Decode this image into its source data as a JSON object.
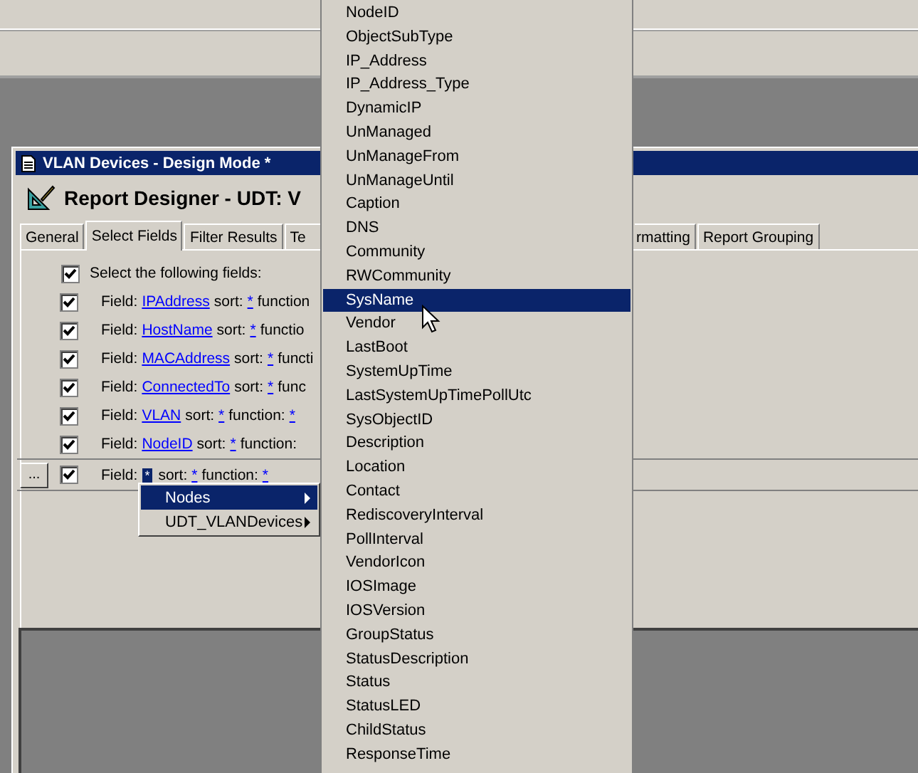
{
  "window": {
    "title": "VLAN Devices - Design Mode *"
  },
  "designer": {
    "title": "Report Designer - UDT: V"
  },
  "tabs": [
    {
      "label": "General",
      "selected": false
    },
    {
      "label": "Select Fields",
      "selected": true
    },
    {
      "label": "Filter Results",
      "selected": false
    },
    {
      "label": "Te",
      "selected": false
    },
    {
      "label": "rmatting",
      "selected": false
    },
    {
      "label": "Report Grouping",
      "selected": false
    }
  ],
  "select_all": {
    "label": "Select the following fields:",
    "checked": true
  },
  "fields": [
    {
      "checked": true,
      "prefix": "Field:",
      "name": "IPAddress",
      "name_selected": false,
      "sort_label": "sort:",
      "sort": "*",
      "function_label": "function"
    },
    {
      "checked": true,
      "prefix": "Field:",
      "name": "HostName",
      "name_selected": false,
      "sort_label": "sort:",
      "sort": "*",
      "function_label": "functio"
    },
    {
      "checked": true,
      "prefix": "Field:",
      "name": "MACAddress",
      "name_selected": false,
      "sort_label": "sort:",
      "sort": "*",
      "function_label": "functi"
    },
    {
      "checked": true,
      "prefix": "Field:",
      "name": "ConnectedTo",
      "name_selected": false,
      "sort_label": "sort:",
      "sort": "*",
      "function_label": "func"
    },
    {
      "checked": true,
      "prefix": "Field:",
      "name": "VLAN",
      "name_selected": false,
      "sort_label": "sort:",
      "sort": "*",
      "function_label": "function:",
      "function_value": "*"
    },
    {
      "checked": true,
      "prefix": "Field:",
      "name": "NodeID",
      "name_selected": false,
      "sort_label": "sort:",
      "sort": "*",
      "function_label": "function:"
    },
    {
      "checked": true,
      "button": "...",
      "prefix": "Field:",
      "name": "*",
      "name_selected": true,
      "sort_label": "sort:",
      "sort": "*",
      "function_label": "function:",
      "function_value": "*"
    }
  ],
  "submenu": [
    {
      "label": "Nodes",
      "selected": true
    },
    {
      "label": "UDT_VLANDevices",
      "selected": false
    }
  ],
  "menu": [
    {
      "label": "NodeID",
      "selected": false
    },
    {
      "label": "ObjectSubType",
      "selected": false
    },
    {
      "label": "IP_Address",
      "selected": false
    },
    {
      "label": "IP_Address_Type",
      "selected": false
    },
    {
      "label": "DynamicIP",
      "selected": false
    },
    {
      "label": "UnManaged",
      "selected": false
    },
    {
      "label": "UnManageFrom",
      "selected": false
    },
    {
      "label": "UnManageUntil",
      "selected": false
    },
    {
      "label": "Caption",
      "selected": false
    },
    {
      "label": "DNS",
      "selected": false
    },
    {
      "label": "Community",
      "selected": false
    },
    {
      "label": "RWCommunity",
      "selected": false
    },
    {
      "label": "SysName",
      "selected": true
    },
    {
      "label": "Vendor",
      "selected": false
    },
    {
      "label": "LastBoot",
      "selected": false
    },
    {
      "label": "SystemUpTime",
      "selected": false
    },
    {
      "label": "LastSystemUpTimePollUtc",
      "selected": false
    },
    {
      "label": "SysObjectID",
      "selected": false
    },
    {
      "label": "Description",
      "selected": false
    },
    {
      "label": "Location",
      "selected": false
    },
    {
      "label": "Contact",
      "selected": false
    },
    {
      "label": "RediscoveryInterval",
      "selected": false
    },
    {
      "label": "PollInterval",
      "selected": false
    },
    {
      "label": "VendorIcon",
      "selected": false
    },
    {
      "label": "IOSImage",
      "selected": false
    },
    {
      "label": "IOSVersion",
      "selected": false
    },
    {
      "label": "GroupStatus",
      "selected": false
    },
    {
      "label": "StatusDescription",
      "selected": false
    },
    {
      "label": "Status",
      "selected": false
    },
    {
      "label": "StatusLED",
      "selected": false
    },
    {
      "label": "ChildStatus",
      "selected": false
    },
    {
      "label": "ResponseTime",
      "selected": false
    }
  ]
}
